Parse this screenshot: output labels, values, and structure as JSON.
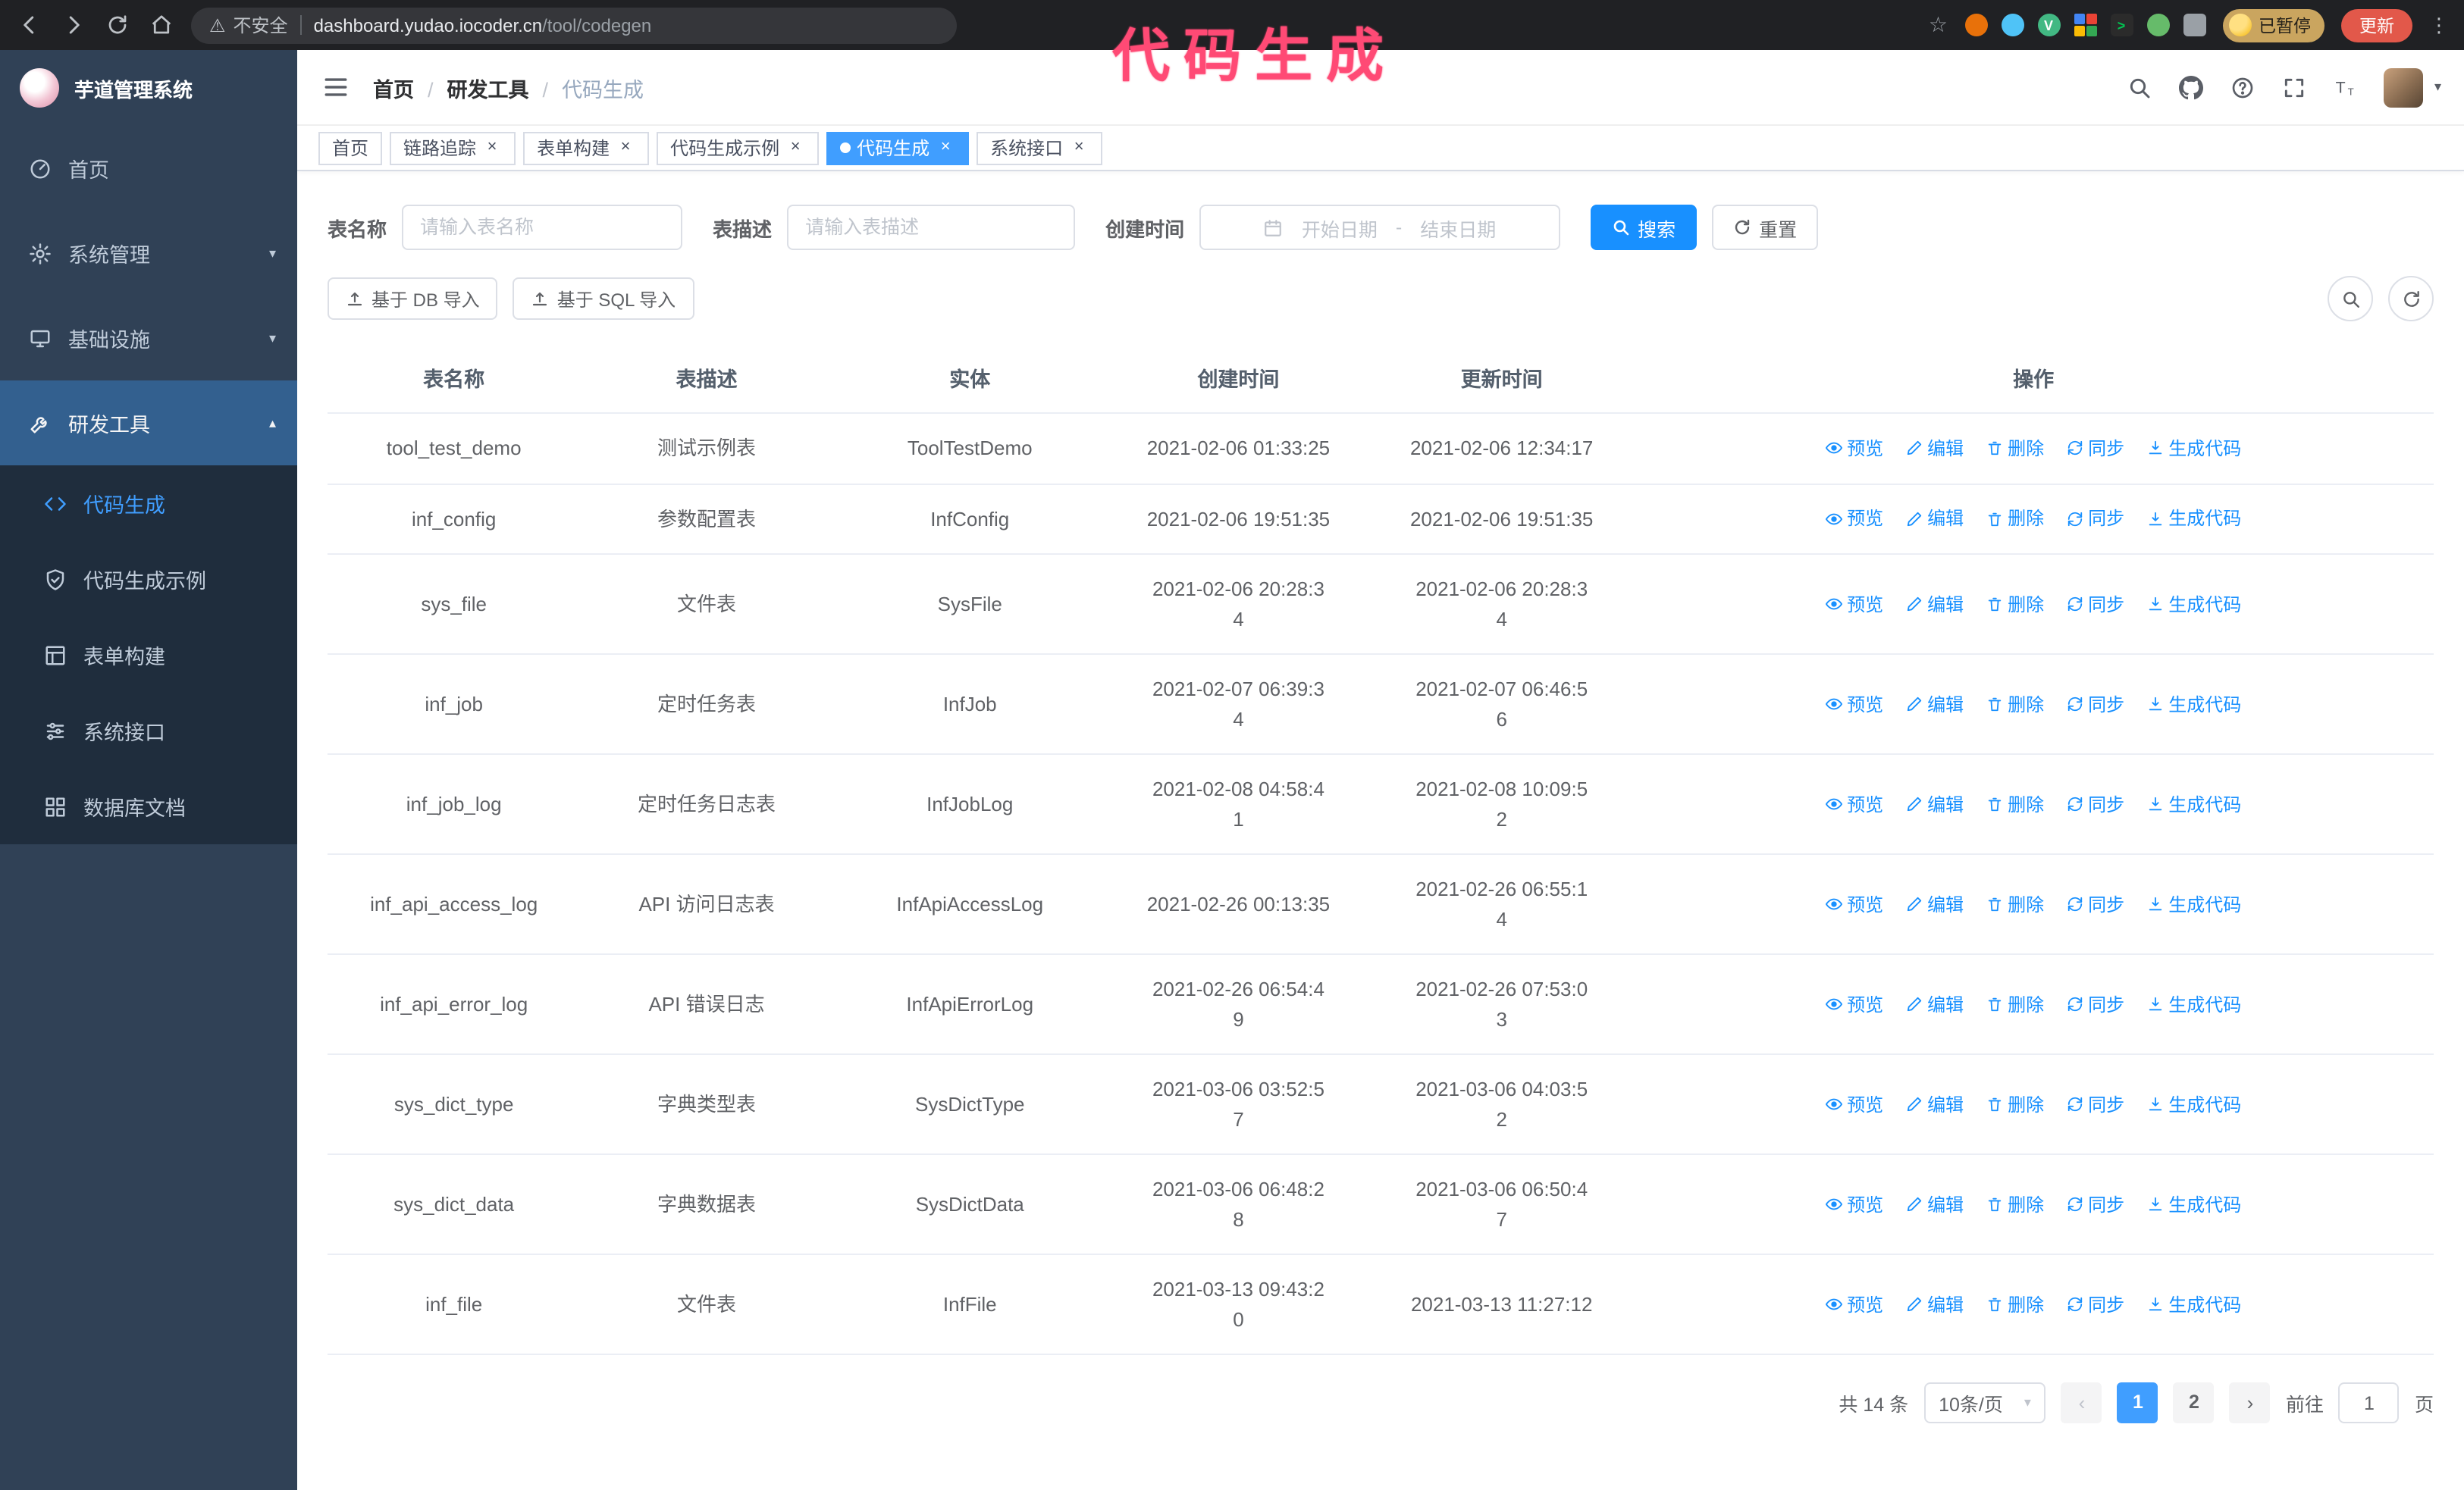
{
  "colors": {
    "accent_blue": "#1890ff",
    "active_tab_blue": "#409eff",
    "sidebar_bg": "#304156",
    "submenu_bg": "#1f2d3d",
    "annotation_pink": "#ff4a75"
  },
  "annotation": {
    "text": "代码生成"
  },
  "browser": {
    "security_label": "不安全",
    "url_host": "dashboard.yudao.iocoder.cn",
    "url_path": "/tool/codegen",
    "paused_badge": "已暂停",
    "update_button": "更新"
  },
  "sidebar": {
    "logo_title": "芋道管理系统",
    "items": [
      {
        "label": "首页"
      },
      {
        "label": "系统管理"
      },
      {
        "label": "基础设施"
      },
      {
        "label": "研发工具"
      }
    ],
    "sub_items": [
      {
        "label": "代码生成"
      },
      {
        "label": "代码生成示例"
      },
      {
        "label": "表单构建"
      },
      {
        "label": "系统接口"
      },
      {
        "label": "数据库文档"
      }
    ]
  },
  "navbar": {
    "breadcrumb": [
      "首页",
      "研发工具",
      "代码生成"
    ]
  },
  "tabs": [
    {
      "label": "首页"
    },
    {
      "label": "链路追踪"
    },
    {
      "label": "表单构建"
    },
    {
      "label": "代码生成示例"
    },
    {
      "label": "代码生成"
    },
    {
      "label": "系统接口"
    }
  ],
  "search": {
    "table_name_label": "表名称",
    "table_name_placeholder": "请输入表名称",
    "table_desc_label": "表描述",
    "table_desc_placeholder": "请输入表描述",
    "create_time_label": "创建时间",
    "start_date_placeholder": "开始日期",
    "range_separator": "-",
    "end_date_placeholder": "结束日期",
    "search_button": "搜索",
    "reset_button": "重置"
  },
  "toolbar": {
    "import_db_button": "基于 DB 导入",
    "import_sql_button": "基于 SQL 导入"
  },
  "table": {
    "columns": [
      "表名称",
      "表描述",
      "实体",
      "创建时间",
      "更新时间",
      "操作"
    ],
    "actions": [
      "预览",
      "编辑",
      "删除",
      "同步",
      "生成代码"
    ],
    "rows": [
      {
        "name": "tool_test_demo",
        "desc": "测试示例表",
        "entity": "ToolTestDemo",
        "created": "2021-02-06 01:33:25",
        "updated": "2021-02-06 12:34:17"
      },
      {
        "name": "inf_config",
        "desc": "参数配置表",
        "entity": "InfConfig",
        "created": "2021-02-06 19:51:35",
        "updated": "2021-02-06 19:51:35"
      },
      {
        "name": "sys_file",
        "desc": "文件表",
        "entity": "SysFile",
        "created": "2021-02-06 20:28:3\n4",
        "updated": "2021-02-06 20:28:3\n4"
      },
      {
        "name": "inf_job",
        "desc": "定时任务表",
        "entity": "InfJob",
        "created": "2021-02-07 06:39:3\n4",
        "updated": "2021-02-07 06:46:5\n6"
      },
      {
        "name": "inf_job_log",
        "desc": "定时任务日志表",
        "entity": "InfJobLog",
        "created": "2021-02-08 04:58:4\n1",
        "updated": "2021-02-08 10:09:5\n2"
      },
      {
        "name": "inf_api_access_log",
        "desc": "API 访问日志表",
        "entity": "InfApiAccessLog",
        "created": "2021-02-26 00:13:35",
        "updated": "2021-02-26 06:55:1\n4"
      },
      {
        "name": "inf_api_error_log",
        "desc": "API 错误日志",
        "entity": "InfApiErrorLog",
        "created": "2021-02-26 06:54:4\n9",
        "updated": "2021-02-26 07:53:0\n3"
      },
      {
        "name": "sys_dict_type",
        "desc": "字典类型表",
        "entity": "SysDictType",
        "created": "2021-03-06 03:52:5\n7",
        "updated": "2021-03-06 04:03:5\n2"
      },
      {
        "name": "sys_dict_data",
        "desc": "字典数据表",
        "entity": "SysDictData",
        "created": "2021-03-06 06:48:2\n8",
        "updated": "2021-03-06 06:50:4\n7"
      },
      {
        "name": "inf_file",
        "desc": "文件表",
        "entity": "InfFile",
        "created": "2021-03-13 09:43:2\n0",
        "updated": "2021-03-13 11:27:12"
      }
    ]
  },
  "pagination": {
    "total_text": "共 14 条",
    "page_size": "10条/页",
    "page_1": "1",
    "page_2": "2",
    "goto_label": "前往",
    "goto_value": "1",
    "page_unit": "页"
  }
}
